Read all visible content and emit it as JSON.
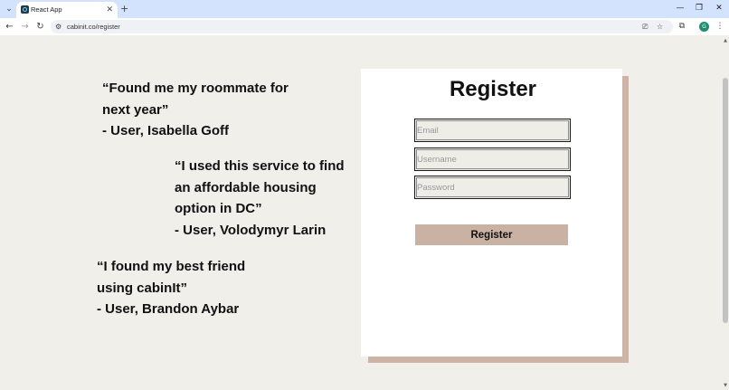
{
  "browser": {
    "tab_title": "React App",
    "url": "cabinit.co/register",
    "avatar_letter": "G",
    "accent_color": "#1e8e6e"
  },
  "testimonials": [
    {
      "lines": [
        "“Found me my roommate for",
        "next year”",
        "- User, Isabella Goff"
      ]
    },
    {
      "lines": [
        "“I used this service to find",
        "an affordable housing",
        "option in DC”",
        "- User, Volodymyr Larin"
      ]
    },
    {
      "lines": [
        "“I found my best friend",
        "using cabinIt”",
        "- User, Brandon Aybar"
      ]
    }
  ],
  "register": {
    "title": "Register",
    "email_placeholder": "Email",
    "username_placeholder": "Username",
    "password_placeholder": "Password",
    "submit_label": "Register",
    "accent_color": "#c9b1a4"
  }
}
